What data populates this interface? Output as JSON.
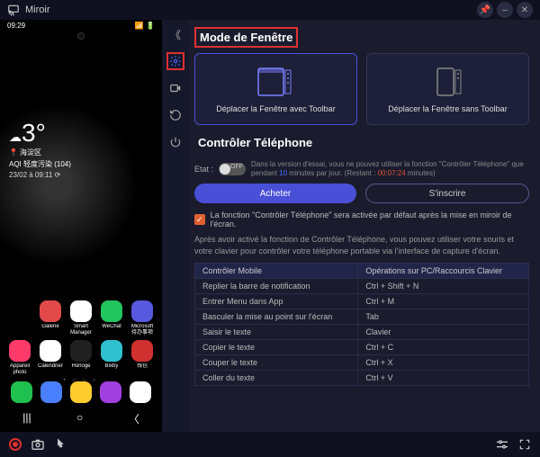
{
  "titlebar": {
    "title": "Miroir"
  },
  "phone": {
    "status_time": "09:29",
    "weather": {
      "temp": "3°",
      "location": "海淀区",
      "aqi": "AQI 轻度污染 (104)",
      "datetime": "23/02 à 09:11 ⟳"
    },
    "apps_row1": [
      {
        "label": "Galerie",
        "bg": "#e24a4a"
      },
      {
        "label": "Smart Manager",
        "bg": "#ffffff"
      },
      {
        "label": "WeChat",
        "bg": "#22c55e"
      },
      {
        "label": "Microsoft 待办事项",
        "bg": "#5858e0"
      }
    ],
    "apps_row2": [
      {
        "label": "Appareil photo",
        "bg": "#ff3b6b"
      },
      {
        "label": "Calendrier",
        "bg": "#ffffff"
      },
      {
        "label": "Horloge",
        "bg": "#202020"
      },
      {
        "label": "Bixby",
        "bg": "#30c0d0"
      },
      {
        "label": "钱包",
        "bg": "#d03030"
      }
    ],
    "dock": [
      {
        "bg": "#20c050"
      },
      {
        "bg": "#4a80ff"
      },
      {
        "bg": "#ffcc30"
      },
      {
        "bg": "#a040e0"
      },
      {
        "bg": "#ffffff"
      }
    ]
  },
  "settings": {
    "section_window": "Mode de Fenêtre",
    "mode1": "Déplacer la Fenêtre avec Toolbar",
    "mode2": "Déplacer la Fenêtre sans Toolbar",
    "section_control": "Contrôler Téléphone",
    "state_label": "Etat :",
    "toggle_off": "OFF",
    "trial_desc_pre": "Dans la version d'essai, vous ne pouvez utiliser la fonction \"Contrôler Téléphone\" que pendant ",
    "trial_minutes": "10",
    "trial_desc_mid": " minutes par jour. (Restant : ",
    "trial_remaining": "00:07:24",
    "trial_desc_post": " minutes)",
    "btn_buy": "Acheter",
    "btn_signup": "S'inscrire",
    "checkbox_label": "La fonction \"Contrôler Téléphone\" sera activée par défaut après la mise en miroir de l'écran.",
    "help_text": "Après avoir activé la fonction de Contrôler Téléphone, vous pouvez utiliser votre souris et votre clavier pour contrôler votre téléphone portable via l'interface de capture d'écran.",
    "table": {
      "col1": "Contrôler Mobile",
      "col2": "Opérations sur PC/Raccourcis Clavier",
      "rows": [
        [
          "Replier la barre de notification",
          "Ctrl + Shift + N"
        ],
        [
          "Entrer Menu dans App",
          "Ctrl + M"
        ],
        [
          "Basculer la mise au point sur l'écran",
          "Tab"
        ],
        [
          "Saisir le texte",
          "Clavier"
        ],
        [
          "Copier le texte",
          "Ctrl + C"
        ],
        [
          "Couper le texte",
          "Ctrl + X"
        ],
        [
          "Coller du texte",
          "Ctrl + V"
        ]
      ]
    }
  }
}
